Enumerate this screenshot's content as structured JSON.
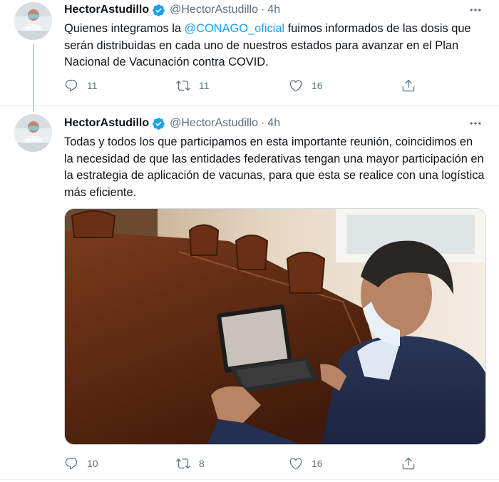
{
  "tweets": [
    {
      "name": "HectorAstudillo",
      "handle": "@HectorAstudillo",
      "separator": "·",
      "time": "4h",
      "text_before": "Quienes integramos la ",
      "mention": "@CONAGO_oficial",
      "text_after": " fuimos informados de las dosis que serán distribuidas en cada uno de nuestros estados para avanzar en el Plan Nacional de Vacunación contra COVID.",
      "replies": "11",
      "retweets": "11",
      "likes": "16"
    },
    {
      "name": "HectorAstudillo",
      "handle": "@HectorAstudillo",
      "separator": "·",
      "time": "4h",
      "text": "Todas y todos los que participamos en esta importante reunión, coincidimos en la necesidad de que las entidades federativas tengan una mayor participación en la estrategia de aplicación de vacunas, para que esta se realice con una logística más eficiente.",
      "replies": "10",
      "retweets": "8",
      "likes": "16"
    }
  ],
  "colors": {
    "accent": "#1da1f2",
    "secondary_text": "#5b7083",
    "primary_text": "#0f1419"
  },
  "icons": [
    "verified-badge-icon",
    "more-options-icon",
    "reply-icon",
    "retweet-icon",
    "like-icon",
    "share-icon"
  ]
}
